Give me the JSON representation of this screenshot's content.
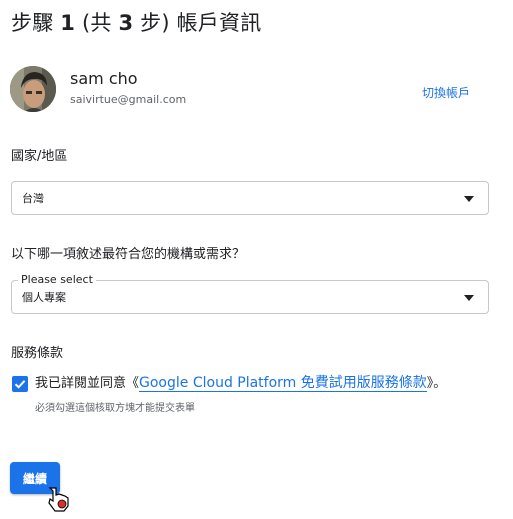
{
  "title": {
    "prefix": "步驟 ",
    "num1": "1",
    "mid": " (共 ",
    "num2": "3",
    "suffix": " 步) 帳戶資訊"
  },
  "account": {
    "name": "sam cho",
    "email": "saivirtue@gmail.com",
    "switch_label": "切換帳戶"
  },
  "country": {
    "label": "國家/地區",
    "value": "台灣"
  },
  "org": {
    "label": "以下哪一項敘述最符合您的機構或需求？",
    "floating_label": "Please select",
    "value": "個人專案"
  },
  "terms": {
    "label": "服務條款",
    "checked": true,
    "prefix": "我已詳閱並同意《",
    "link": "Google Cloud Platform 免費試用版服務條款",
    "suffix": "》。",
    "hint": "必須勾選這個核取方塊才能提交表單"
  },
  "continue_label": "繼續",
  "colors": {
    "accent": "#1a73e8",
    "text": "#202124",
    "muted": "#5f6368"
  },
  "icons": {
    "checkbox": "check-icon",
    "dropdown": "dropdown-arrow-icon",
    "cursor": "hand-pointer-icon"
  }
}
